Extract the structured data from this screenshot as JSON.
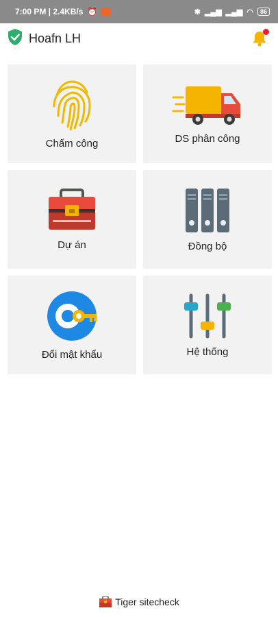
{
  "status_bar": {
    "time_speed": "7:00 PM | 2.4KB/s",
    "battery": "86"
  },
  "app_bar": {
    "title": "Hoafn LH"
  },
  "tiles": [
    {
      "label": "Chấm công",
      "icon": "fingerprint-icon"
    },
    {
      "label": "DS phân công",
      "icon": "delivery-truck-icon"
    },
    {
      "label": "Dự án",
      "icon": "toolbox-icon"
    },
    {
      "label": "Đồng bộ",
      "icon": "server-binders-icon"
    },
    {
      "label": "Đổi mật khẩu",
      "icon": "key-icon"
    },
    {
      "label": "Hệ thống",
      "icon": "sliders-icon"
    }
  ],
  "footer": {
    "label": "Tiger sitecheck"
  },
  "colors": {
    "brand_green": "#2eae6a",
    "bell_yellow": "#f5b400",
    "tile_bg": "#f2f2f2"
  }
}
